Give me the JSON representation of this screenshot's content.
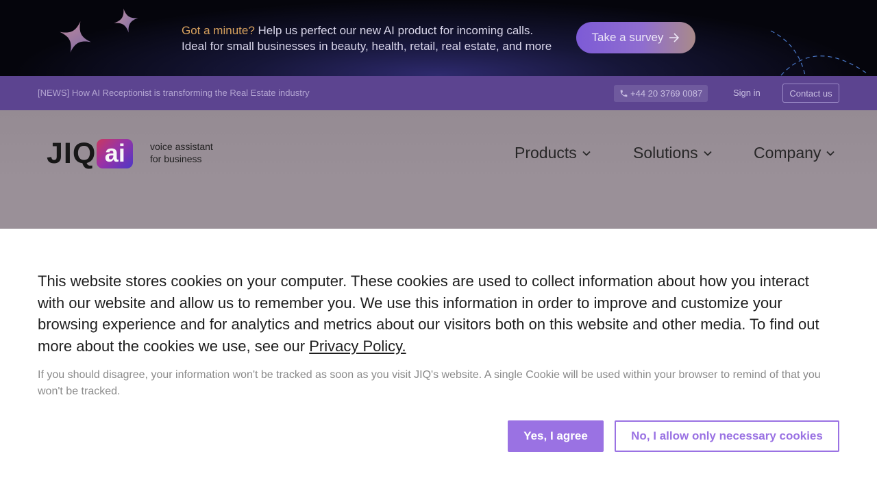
{
  "promo": {
    "highlight": "Got a minute?",
    "line1_rest": " Help us perfect our new AI product for incoming calls.",
    "line2": "Ideal for small businesses in beauty, health, retail, real estate, and more",
    "survey_button": "Take a survey"
  },
  "topbar": {
    "news": "[NEWS] How AI Receptionist is transforming the Real Estate industry",
    "phone": "+44 20 3769 0087",
    "signin": "Sign in",
    "contact": "Contact us"
  },
  "header": {
    "logo_text": "JIQ",
    "logo_badge": "ai",
    "tagline_line1": "voice assistant",
    "tagline_line2": "for business",
    "nav": [
      {
        "label": "Products"
      },
      {
        "label": "Solutions"
      },
      {
        "label": "Company"
      }
    ]
  },
  "cookie": {
    "main_text": "This website stores cookies on your computer. These cookies are used to collect information about how you interact with our website and allow us to remember you. We use this information in order to improve and customize your browsing experience and for analytics and metrics about our visitors both on this website and other media. To find out more about the cookies we use, see our ",
    "policy_link": "Privacy Policy.",
    "sub_text": "If you should disagree, your information won't be tracked as soon as you visit JIQ's website. A single Cookie will be used within your browser to remind of that you won't be tracked.",
    "agree_button": "Yes, I agree",
    "necessary_button": "No, I allow only necessary cookies"
  },
  "colors": {
    "promo_highlight": "#d7a15e",
    "topbar_bg": "#5c4490",
    "accent": "#9a72e3"
  },
  "icons": [
    "sparkle-icon",
    "arrow-right-icon",
    "phone-icon",
    "chevron-down-icon"
  ]
}
